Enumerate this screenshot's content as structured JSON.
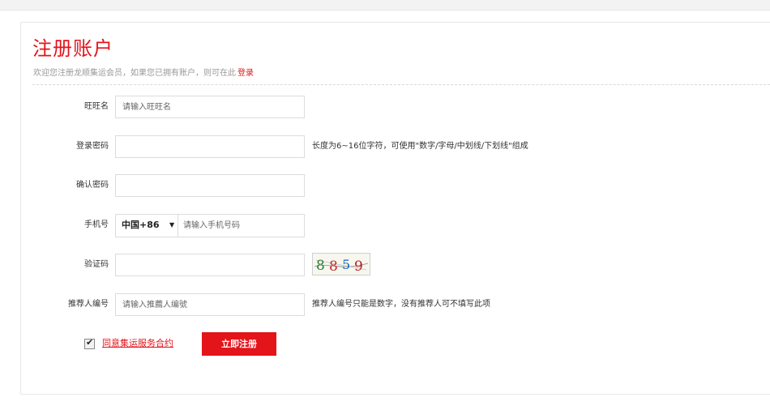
{
  "form": {
    "title": "注册账户",
    "subtitle": "欢迎您注册龙顺集运会员，如果您已拥有账户，则可在此",
    "login_link": "登录",
    "fields": {
      "wangwang": {
        "label": "旺旺名",
        "placeholder": "请输入旺旺名",
        "value": ""
      },
      "password": {
        "label": "登录密码",
        "value": "",
        "hint": "长度为6~16位字符，可使用\"数字/字母/中划线/下划线\"组成"
      },
      "confirm_password": {
        "label": "确认密码",
        "value": ""
      },
      "phone": {
        "label": "手机号",
        "country_code": "中国+86",
        "placeholder": "请输入手机号码",
        "value": ""
      },
      "captcha": {
        "label": "验证码",
        "value": "",
        "captcha_text": "8859"
      },
      "referrer": {
        "label": "推荐人编号",
        "placeholder": "请输入推薦人编號",
        "value": "",
        "hint": "推荐人编号只能是数字，没有推荐人可不填写此项"
      }
    },
    "agreement": {
      "checked": true,
      "label": "同意集运服务合约"
    },
    "submit_label": "立即注册"
  },
  "colors": {
    "accent": "#e4141b",
    "border": "#dcdcdc",
    "muted_text": "#999999"
  },
  "icons": {
    "checkbox": "checkmark-icon",
    "select": "caret-down-icon"
  }
}
